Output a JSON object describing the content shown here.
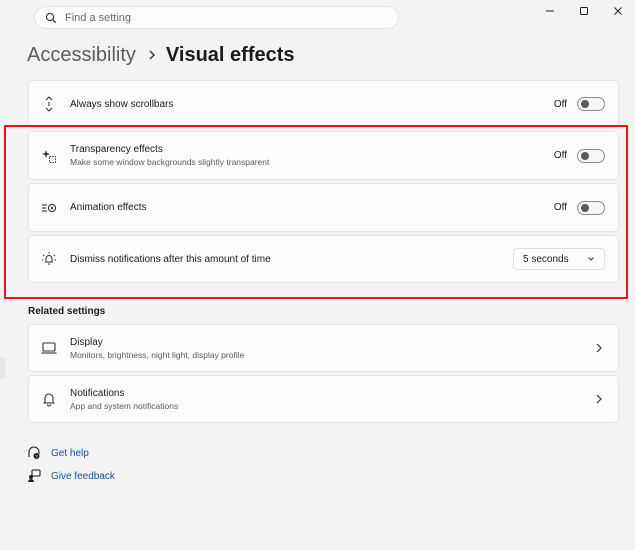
{
  "search": {
    "placeholder": "Find a setting"
  },
  "breadcrumb": {
    "parent": "Accessibility",
    "current": "Visual effects"
  },
  "settings": {
    "scrollbars": {
      "title": "Always show scrollbars",
      "state": "Off"
    },
    "transparency": {
      "title": "Transparency effects",
      "subtitle": "Make some window backgrounds slightly transparent",
      "state": "Off"
    },
    "animation": {
      "title": "Animation effects",
      "state": "Off"
    },
    "dismiss": {
      "title": "Dismiss notifications after this amount of time",
      "value": "5 seconds"
    }
  },
  "related": {
    "title": "Related settings",
    "display": {
      "title": "Display",
      "subtitle": "Monitors, brightness, night light, display profile"
    },
    "notifications": {
      "title": "Notifications",
      "subtitle": "App and system notifications"
    }
  },
  "links": {
    "help": "Get help",
    "feedback": "Give feedback"
  },
  "colors": {
    "highlight": "#e8131b",
    "link": "#1a4f8f",
    "background": "#f3f3f3",
    "card": "#fbfbfb"
  },
  "icons": [
    "search-icon",
    "minimize-icon",
    "maximize-icon",
    "close-icon",
    "chevron-right-icon",
    "scroll-arrows-icon",
    "transparency-sparkle-icon",
    "animation-icon",
    "notification-bell-timer-icon",
    "chevron-down-icon",
    "monitor-icon",
    "bell-icon",
    "help-icon",
    "feedback-icon"
  ]
}
